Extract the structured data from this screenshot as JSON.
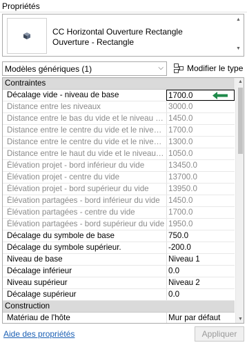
{
  "window": {
    "title": "Propriétés"
  },
  "type_selector": {
    "family": "CC Horizontal Ouverture Rectangle",
    "type": "Ouverture - Rectangle"
  },
  "filter": {
    "category": "Modèles génériques (1)",
    "edit_type_label": "Modifier le type"
  },
  "groups": {
    "constraints": "Contraintes",
    "construction": "Construction"
  },
  "rows": [
    {
      "label": "Décalage vide - niveau de base",
      "value": "1700.0"
    },
    {
      "label": "Distance entre les niveaux",
      "value": "3000.0"
    },
    {
      "label": "Distance entre le bas du vide et le niveau de...",
      "value": "1450.0"
    },
    {
      "label": "Distance entre le centre du vide et le niveau...",
      "value": "1700.0"
    },
    {
      "label": "Distance entre le centre du vide et le niveau...",
      "value": "1300.0"
    },
    {
      "label": "Distance entre le haut du vide et le niveau s...",
      "value": "1050.0"
    },
    {
      "label": "Élévation projet -  bord inférieur du vide",
      "value": "13450.0"
    },
    {
      "label": "Élévation projet - centre du vide",
      "value": "13700.0"
    },
    {
      "label": "Élévation projet - bord supérieur du vide",
      "value": "13950.0"
    },
    {
      "label": "Élévation partagées - bord inférieur du vide",
      "value": "1450.0"
    },
    {
      "label": "Élévation partagées - centre du vide",
      "value": "1700.0"
    },
    {
      "label": "Élévation partagées - bord supérieur du vide",
      "value": "1950.0"
    },
    {
      "label": "Décalage du symbole de base",
      "value": "750.0"
    },
    {
      "label": "Décalage du symbole supérieur.",
      "value": "-200.0"
    },
    {
      "label": "Niveau de base",
      "value": "Niveau 1"
    },
    {
      "label": "Décalage inférieur",
      "value": "0.0"
    },
    {
      "label": "Niveau supérieur",
      "value": "Niveau 2"
    },
    {
      "label": "Décalage supérieur",
      "value": "0.0"
    },
    {
      "label": "Matériau de l'hôte",
      "value": "Mur par défaut"
    }
  ],
  "footer": {
    "help_link": "Aide des propriétés",
    "apply_label": "Appliquer"
  },
  "colors": {
    "arrow": "#1e8a4a",
    "link": "#1a5fb4",
    "group_bg": "#dadada",
    "disabled_text": "#8a8a8a"
  },
  "icons": [
    "family-3d-icon",
    "edit-type-icon",
    "dropdown-chevron-icon",
    "annotation-arrow-icon"
  ]
}
